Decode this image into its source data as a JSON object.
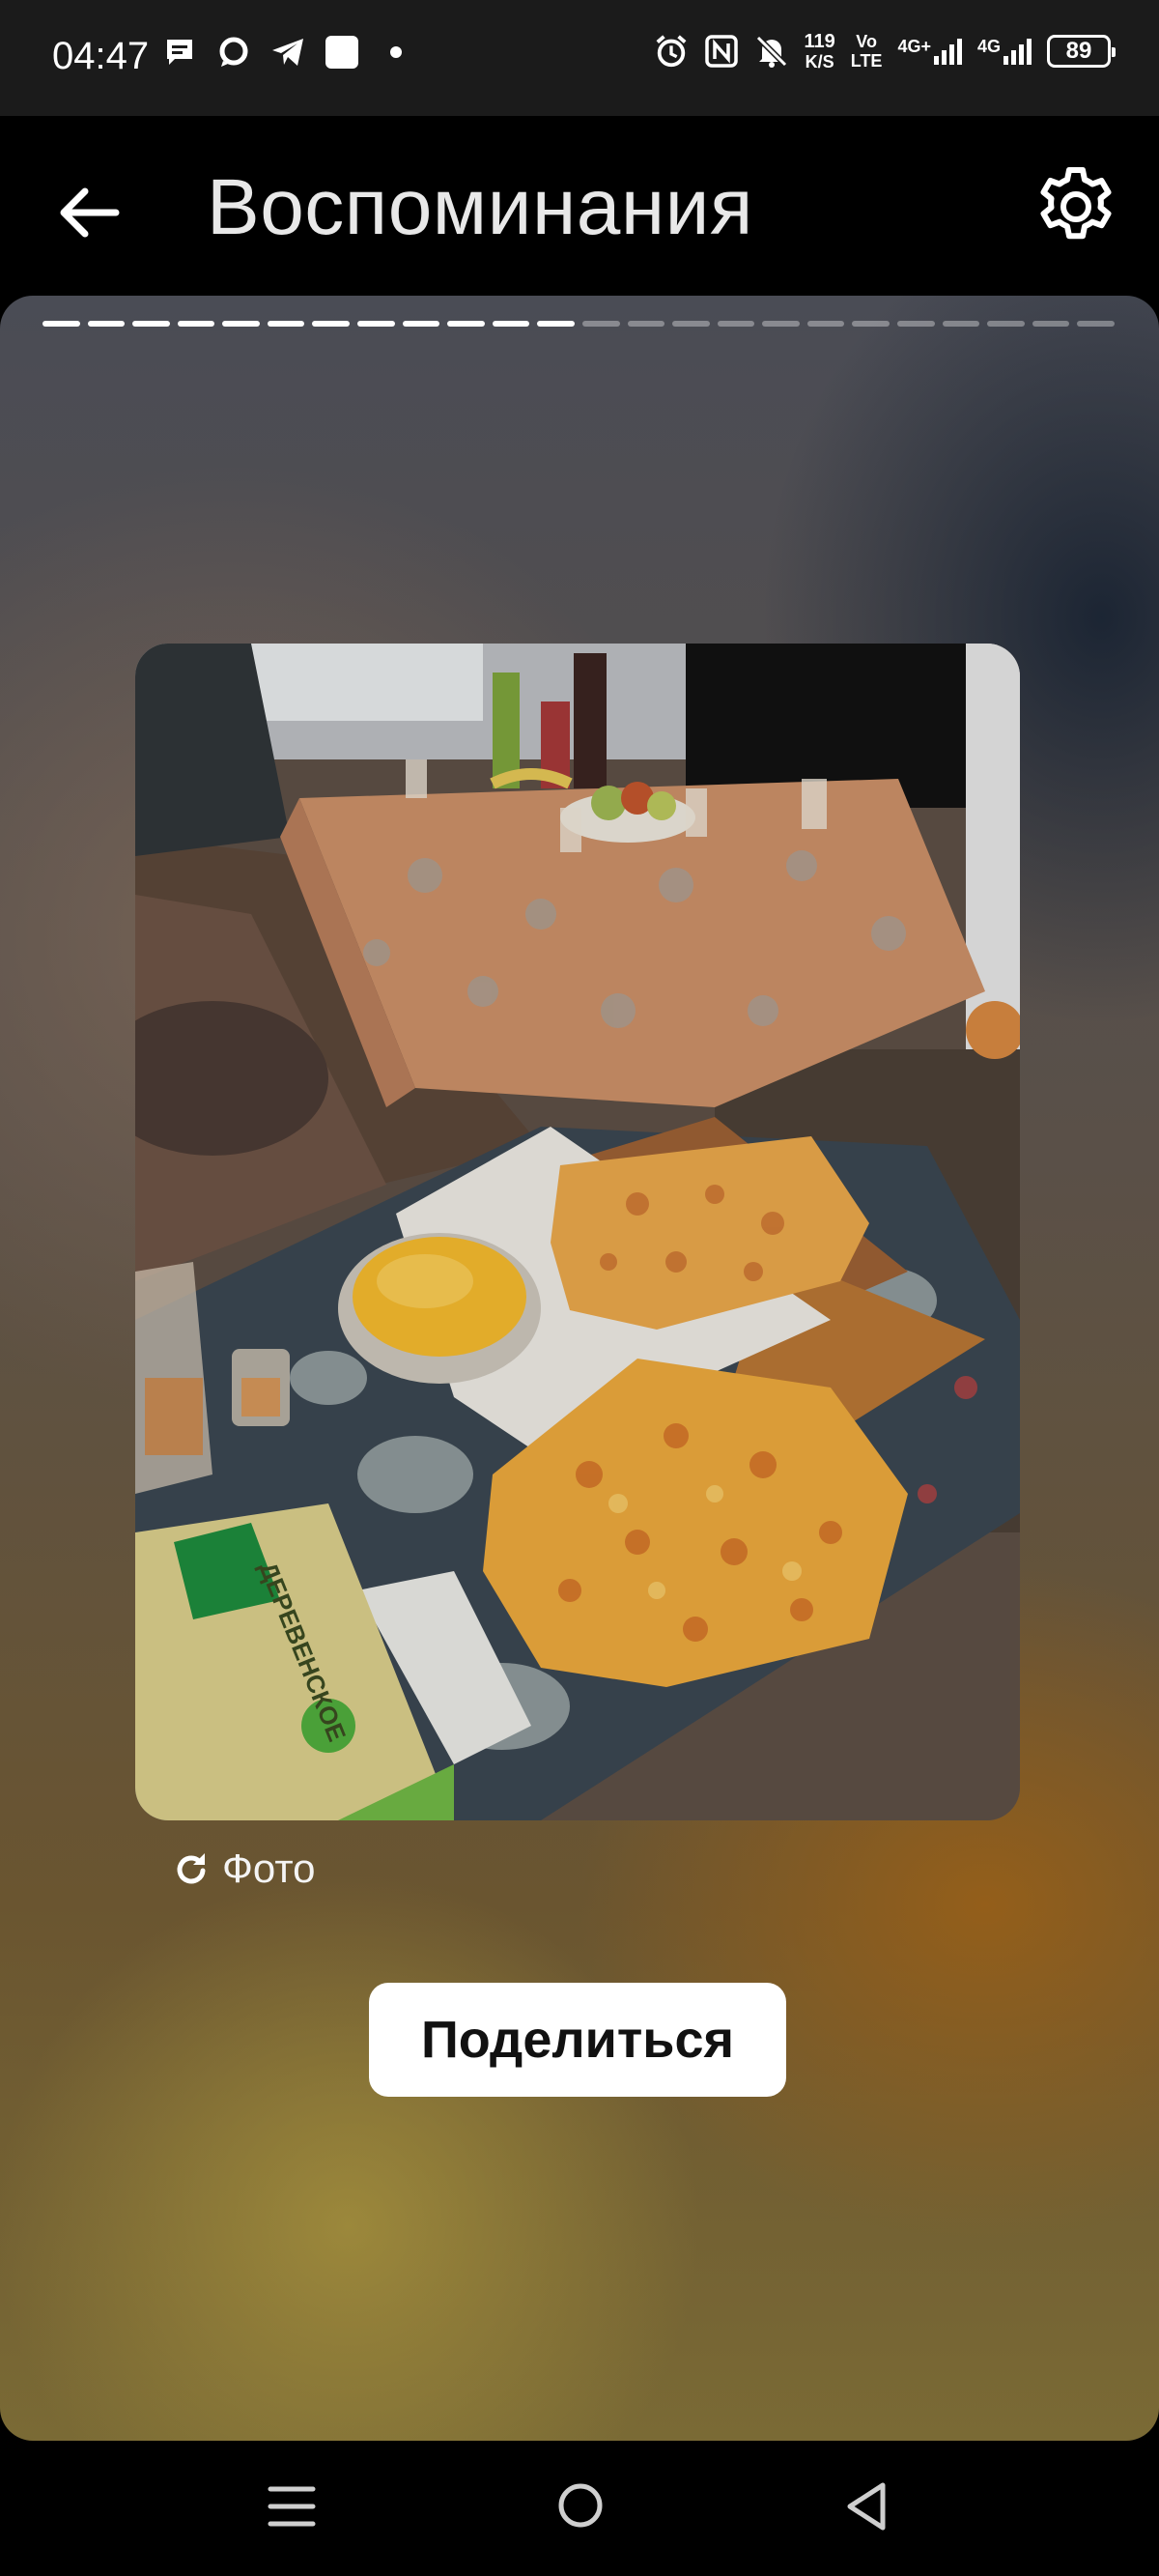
{
  "status_bar": {
    "time": "04:47",
    "net_speed": "119",
    "net_speed_unit": "K/S",
    "volte_top": "Vo",
    "volte_bottom": "LTE",
    "sim1": "4G+",
    "sim2": "4G",
    "battery": "89",
    "icons_left": [
      "message-icon",
      "chat-bubble-icon",
      "telegram-icon",
      "app-square-icon",
      "more-dot-icon"
    ],
    "icons_right": [
      "alarm-icon",
      "nfc-icon",
      "mute-icon",
      "signal-icon",
      "battery-icon"
    ]
  },
  "header": {
    "title": "Воспоминания"
  },
  "story": {
    "progress_total": 24,
    "progress_done": 12,
    "photo_caption": "Фото",
    "share_label": "Поделиться"
  },
  "photo_content": {
    "package_text": "ДЕРЕВЕНСКОЕ"
  }
}
